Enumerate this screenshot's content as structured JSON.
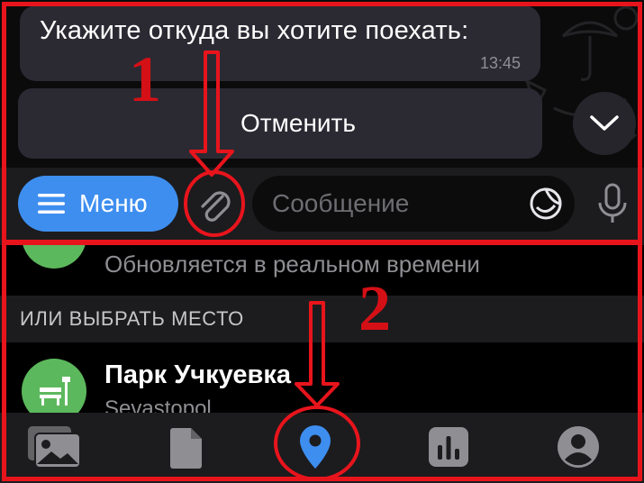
{
  "chat": {
    "message_text": "Укажите откуда вы хотите поехать:",
    "message_time": "13:45",
    "cancel_label": "Отменить",
    "scroll_down_icon": "chevron-down-icon"
  },
  "input_bar": {
    "menu_label": "Меню",
    "message_placeholder": "Сообщение",
    "attach_icon": "paperclip-icon",
    "sticker_icon": "sticker-icon",
    "mic_icon": "microphone-icon",
    "accent_color": "#3e8ef0"
  },
  "location": {
    "live_subtitle": "Обновляется в реальном времени",
    "section_header": "ИЛИ ВЫБРАТЬ МЕСТО",
    "place": {
      "name": "Парк Учкуевка",
      "subtitle": "Sevastopol",
      "icon": "park-bench-icon",
      "color": "#5cb85c"
    }
  },
  "tabbar": {
    "tabs": [
      {
        "icon": "gallery-icon",
        "active": false
      },
      {
        "icon": "file-icon",
        "active": false
      },
      {
        "icon": "location-pin-icon",
        "active": true
      },
      {
        "icon": "poll-icon",
        "active": false
      },
      {
        "icon": "contact-icon",
        "active": false
      }
    ],
    "active_color": "#3e8ef0"
  },
  "annotations": {
    "step_1": "1",
    "step_2": "2",
    "color": "#e8141c"
  }
}
